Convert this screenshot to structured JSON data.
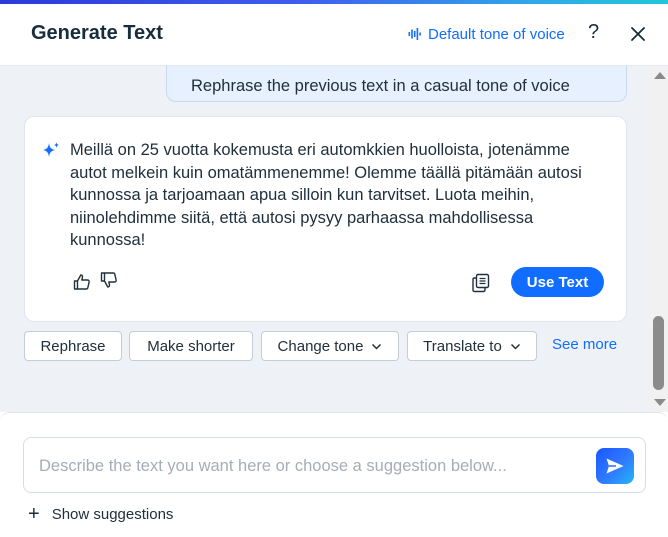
{
  "header": {
    "title": "Generate Text",
    "tone_label": "Default tone of voice",
    "tone_icon": "sound-wave-icon",
    "help_label": "?",
    "close_icon": "close-icon"
  },
  "chat": {
    "user_message": "Rephrase the previous text in a casual tone of voice",
    "ai_message": "Meillä on 25 vuotta kokemusta eri automkkien huolloista, jotenämme autot melkein kuin omatämmenemme! Olemme täällä pitämään autosi kunnossa ja tarjoamaan apua silloin kun tarvitset. Luota meihin, niinolehdimme siitä, että autosi pysyy parhaassa mahdollisessa kunnossa!",
    "use_text_label": "Use Text",
    "icons": [
      "sparkle-icon",
      "thumbs-up-icon",
      "thumbs-down-icon",
      "copy-icon"
    ]
  },
  "actions": {
    "chips": [
      "Rephrase",
      "Make shorter",
      "Change tone",
      "Translate to"
    ],
    "see_more": "See more"
  },
  "footer": {
    "placeholder": "Describe the text you want here or choose a suggestion below...",
    "show_suggestions": "Show suggestions"
  },
  "colors": {
    "accent": "#116dff",
    "chat_background": "#eef1f5",
    "user_bubble": "#e7f0ff"
  }
}
